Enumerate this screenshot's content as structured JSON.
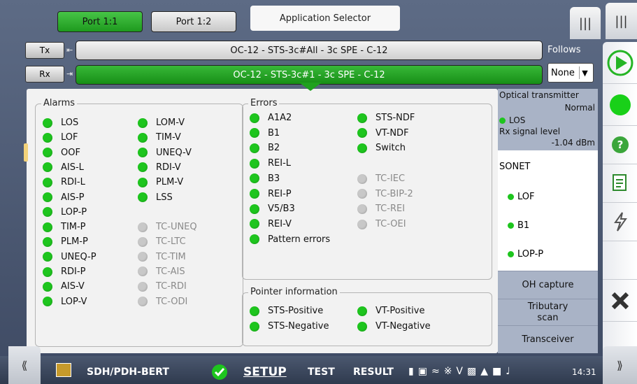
{
  "tabs": {
    "port1": "Port 1:1",
    "port2": "Port 1:2",
    "app_selector": "Application Selector"
  },
  "signal": {
    "tx_label": "Tx",
    "rx_label": "Rx",
    "tx_path": "OC-12 - STS-3c#All - 3c SPE - C-12",
    "rx_path": "OC-12 - STS-3c#1 - 3c SPE - C-12",
    "follows_label": "Follows",
    "follows_value": "None"
  },
  "alarms": {
    "title": "Alarms",
    "col1": [
      "LOS",
      "LOF",
      "OOF",
      "AIS-L",
      "RDI-L",
      "AIS-P",
      "LOP-P",
      "TIM-P",
      "PLM-P",
      "UNEQ-P",
      "RDI-P",
      "AIS-V",
      "LOP-V"
    ],
    "col2_active": [
      "LOM-V",
      "TIM-V",
      "UNEQ-V",
      "RDI-V",
      "PLM-V",
      "LSS"
    ],
    "col2_inactive": [
      "TC-UNEQ",
      "TC-LTC",
      "TC-TIM",
      "TC-AIS",
      "TC-RDI",
      "TC-ODI"
    ]
  },
  "errors": {
    "title": "Errors",
    "col1": [
      "A1A2",
      "B1",
      "B2",
      "REI-L",
      "B3",
      "REI-P",
      "V5/B3",
      "REI-V",
      "Pattern errors"
    ],
    "col2_active": [
      "STS-NDF",
      "VT-NDF",
      "Switch"
    ],
    "col2_inactive": [
      "TC-IEC",
      "TC-BIP-2",
      "TC-REI",
      "TC-OEI"
    ]
  },
  "pointer": {
    "title": "Pointer information",
    "items": [
      "STS-Positive",
      "STS-Negative",
      "VT-Positive",
      "VT-Negative"
    ]
  },
  "optical": {
    "title": "Optical transmitter",
    "status": "Normal",
    "los": "LOS",
    "rx_label": "Rx signal level",
    "rx_value": "-1.04 dBm"
  },
  "sonet": {
    "title": "SONET",
    "items": [
      "LOF",
      "B1",
      "LOP-P"
    ]
  },
  "right_buttons": {
    "oh": "OH capture",
    "trib": "Tributary scan",
    "trans": "Transceiver"
  },
  "bottom": {
    "app": "SDH/PDH-BERT",
    "setup": "SETUP",
    "test": "TEST",
    "result": "RESULT",
    "time": "14:31"
  },
  "colors": {
    "active_green": "#1ec51e",
    "inactive_gray": "#c8c8c8",
    "panel_blue": "#a9b3c6"
  }
}
